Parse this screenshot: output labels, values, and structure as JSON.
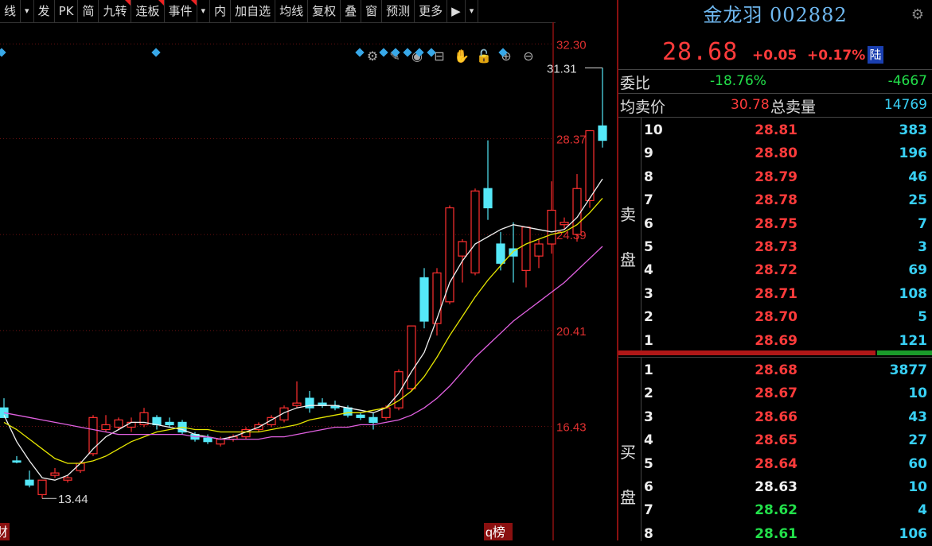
{
  "toolbar": {
    "items": [
      {
        "label": "线",
        "flag": false
      },
      {
        "label": "▾",
        "flag": false
      },
      {
        "label": "发",
        "flag": false
      },
      {
        "label": "PK",
        "flag": false
      },
      {
        "label": "简",
        "flag": false
      },
      {
        "label": "九转",
        "flag": true
      },
      {
        "label": "连板",
        "flag": true
      },
      {
        "label": "事件",
        "flag": true
      },
      {
        "label": "▾",
        "flag": false
      },
      {
        "label": "内",
        "flag": false
      },
      {
        "label": "加自选",
        "flag": false
      },
      {
        "label": "均线",
        "flag": false
      },
      {
        "label": "复权",
        "flag": false
      },
      {
        "label": "叠",
        "flag": false
      },
      {
        "label": "窗",
        "flag": false
      },
      {
        "label": "预测",
        "flag": false
      },
      {
        "label": "更多",
        "flag": false
      },
      {
        "label": "▶",
        "flag": false
      },
      {
        "label": "▾",
        "flag": false
      }
    ]
  },
  "chart_tools": [
    "gear-icon",
    "pen-icon",
    "eye-icon",
    "lock-box-icon",
    "hand-icon",
    "lock-icon",
    "zoom-in-icon",
    "zoom-out-icon"
  ],
  "chart_tool_glyphs": [
    "⚙",
    "✎",
    "◉",
    "⊟",
    "✋",
    "🔓",
    "⊕",
    "⊖"
  ],
  "chart_data": {
    "type": "candlestick",
    "y_ticks": [
      "32.30",
      "28.37",
      "24.39",
      "20.41",
      "16.43"
    ],
    "y_tick_values": [
      32.3,
      28.37,
      24.39,
      20.41,
      16.43
    ],
    "ylim": [
      11.7,
      33.2
    ],
    "annotations": [
      {
        "text": "31.31",
        "value": 31.31,
        "kind": "high"
      },
      {
        "text": "13.44",
        "value": 13.44,
        "kind": "low"
      }
    ],
    "bottom_labels": [
      "财",
      "q榜"
    ],
    "candles": [
      {
        "o": 17.2,
        "h": 17.6,
        "l": 17.0,
        "c": 16.8
      },
      {
        "o": 15.0,
        "h": 15.2,
        "l": 14.9,
        "c": 14.95
      },
      {
        "o": 14.2,
        "h": 14.6,
        "l": 13.9,
        "c": 14.0
      },
      {
        "o": 13.6,
        "h": 14.2,
        "l": 13.44,
        "c": 14.2
      },
      {
        "o": 14.4,
        "h": 14.7,
        "l": 14.3,
        "c": 14.5
      },
      {
        "o": 14.2,
        "h": 14.4,
        "l": 14.1,
        "c": 14.3
      },
      {
        "o": 14.6,
        "h": 15.0,
        "l": 14.5,
        "c": 14.9
      },
      {
        "o": 15.3,
        "h": 16.9,
        "l": 15.2,
        "c": 16.8
      },
      {
        "o": 16.3,
        "h": 16.9,
        "l": 16.2,
        "c": 16.5
      },
      {
        "o": 16.4,
        "h": 16.8,
        "l": 16.3,
        "c": 16.7
      },
      {
        "o": 16.4,
        "h": 16.8,
        "l": 16.2,
        "c": 16.6
      },
      {
        "o": 16.5,
        "h": 17.2,
        "l": 16.4,
        "c": 17.0
      },
      {
        "o": 16.8,
        "h": 16.9,
        "l": 16.3,
        "c": 16.5
      },
      {
        "o": 16.6,
        "h": 16.8,
        "l": 16.4,
        "c": 16.5
      },
      {
        "o": 16.6,
        "h": 16.7,
        "l": 16.1,
        "c": 16.2
      },
      {
        "o": 16.1,
        "h": 16.2,
        "l": 15.8,
        "c": 15.9
      },
      {
        "o": 15.95,
        "h": 16.1,
        "l": 15.7,
        "c": 15.8
      },
      {
        "o": 15.7,
        "h": 16.0,
        "l": 15.6,
        "c": 15.9
      },
      {
        "o": 15.9,
        "h": 16.1,
        "l": 15.8,
        "c": 16.0
      },
      {
        "o": 16.0,
        "h": 16.4,
        "l": 15.9,
        "c": 16.3
      },
      {
        "o": 16.3,
        "h": 16.6,
        "l": 16.2,
        "c": 16.5
      },
      {
        "o": 16.5,
        "h": 16.9,
        "l": 16.4,
        "c": 16.8
      },
      {
        "o": 16.7,
        "h": 17.3,
        "l": 16.6,
        "c": 17.2
      },
      {
        "o": 17.3,
        "h": 18.3,
        "l": 17.2,
        "c": 17.4
      },
      {
        "o": 17.6,
        "h": 17.9,
        "l": 17.0,
        "c": 17.2
      },
      {
        "o": 17.4,
        "h": 17.6,
        "l": 17.2,
        "c": 17.3
      },
      {
        "o": 17.3,
        "h": 17.5,
        "l": 17.1,
        "c": 17.2
      },
      {
        "o": 17.2,
        "h": 17.3,
        "l": 16.8,
        "c": 16.9
      },
      {
        "o": 16.9,
        "h": 17.0,
        "l": 16.7,
        "c": 16.8
      },
      {
        "o": 16.8,
        "h": 17.0,
        "l": 16.3,
        "c": 16.6
      },
      {
        "o": 16.8,
        "h": 17.3,
        "l": 16.7,
        "c": 17.2
      },
      {
        "o": 17.2,
        "h": 18.8,
        "l": 17.1,
        "c": 18.7
      },
      {
        "o": 18.0,
        "h": 20.6,
        "l": 17.9,
        "c": 20.6
      },
      {
        "o": 22.6,
        "h": 23.0,
        "l": 20.5,
        "c": 20.8
      },
      {
        "o": 20.7,
        "h": 23.0,
        "l": 20.2,
        "c": 22.8
      },
      {
        "o": 21.6,
        "h": 25.6,
        "l": 21.5,
        "c": 25.5
      },
      {
        "o": 23.5,
        "h": 24.2,
        "l": 22.4,
        "c": 24.1
      },
      {
        "o": 22.8,
        "h": 26.3,
        "l": 22.7,
        "c": 26.2
      },
      {
        "o": 26.3,
        "h": 28.3,
        "l": 25.0,
        "c": 25.5
      },
      {
        "o": 24.0,
        "h": 24.5,
        "l": 22.9,
        "c": 23.2
      },
      {
        "o": 23.8,
        "h": 24.9,
        "l": 22.4,
        "c": 23.5
      },
      {
        "o": 22.9,
        "h": 24.7,
        "l": 22.2,
        "c": 24.7
      },
      {
        "o": 23.5,
        "h": 24.2,
        "l": 23.0,
        "c": 24.0
      },
      {
        "o": 24.0,
        "h": 26.6,
        "l": 23.6,
        "c": 25.4
      },
      {
        "o": 24.8,
        "h": 25.1,
        "l": 24.6,
        "c": 24.9
      },
      {
        "o": 24.4,
        "h": 26.9,
        "l": 24.1,
        "c": 26.3
      },
      {
        "o": 25.8,
        "h": 28.7,
        "l": 25.5,
        "c": 28.7
      },
      {
        "o": 28.9,
        "h": 31.31,
        "l": 28.0,
        "c": 28.3
      }
    ],
    "ma": [
      {
        "name": "MA5",
        "color": "#f0f0f0",
        "values": [
          16.9,
          15.8,
          15.0,
          14.3,
          14.2,
          14.4,
          14.9,
          15.5,
          16.0,
          16.3,
          16.6,
          16.6,
          16.5,
          16.4,
          16.3,
          16.1,
          16.0,
          15.9,
          16.0,
          16.2,
          16.4,
          16.7,
          17.0,
          17.2,
          17.3,
          17.3,
          17.3,
          17.2,
          17.1,
          17.0,
          17.2,
          17.8,
          18.7,
          19.5,
          20.9,
          22.4,
          23.3,
          24.0,
          24.3,
          24.6,
          24.8,
          24.7,
          24.6,
          24.5,
          24.6,
          25.1,
          25.9,
          26.7
        ]
      },
      {
        "name": "MA10",
        "color": "#e6e600",
        "values": [
          16.6,
          16.3,
          15.9,
          15.5,
          15.1,
          14.9,
          14.9,
          15.0,
          15.2,
          15.5,
          15.8,
          16.0,
          16.2,
          16.3,
          16.4,
          16.3,
          16.3,
          16.2,
          16.2,
          16.2,
          16.2,
          16.3,
          16.4,
          16.5,
          16.7,
          16.8,
          16.9,
          17.0,
          17.0,
          17.1,
          17.2,
          17.5,
          17.9,
          18.5,
          19.3,
          20.2,
          21.0,
          21.8,
          22.5,
          23.1,
          23.7,
          24.0,
          24.2,
          24.4,
          24.5,
          24.8,
          25.3,
          25.9
        ]
      },
      {
        "name": "MA20",
        "color": "#e060e0",
        "values": [
          17.0,
          16.9,
          16.8,
          16.7,
          16.6,
          16.5,
          16.4,
          16.3,
          16.2,
          16.1,
          16.1,
          16.1,
          16.1,
          16.1,
          16.1,
          16.0,
          16.0,
          15.9,
          15.9,
          15.9,
          15.9,
          16.0,
          16.0,
          16.1,
          16.2,
          16.3,
          16.4,
          16.4,
          16.5,
          16.5,
          16.6,
          16.7,
          16.9,
          17.2,
          17.6,
          18.1,
          18.7,
          19.3,
          19.8,
          20.3,
          20.8,
          21.2,
          21.6,
          22.0,
          22.4,
          22.9,
          23.4,
          23.9
        ]
      }
    ]
  },
  "quote": {
    "title": "金龙羽 002882",
    "price": "28.68",
    "change": "+0.05",
    "change_pct": "+0.17%",
    "market": "陆",
    "ratio_label": "委比",
    "ratio_pct": "-18.76%",
    "ratio_val": "-4667",
    "avg_label": "均卖价",
    "avg_val": "30.78",
    "total_label": "总卖量",
    "total_val": "14769",
    "sell_side": "卖盘",
    "buy_side": "买盘",
    "sells": [
      {
        "n": "10",
        "p": "28.81",
        "s": "383"
      },
      {
        "n": "9",
        "p": "28.80",
        "s": "196"
      },
      {
        "n": "8",
        "p": "28.79",
        "s": "46"
      },
      {
        "n": "7",
        "p": "28.78",
        "s": "25"
      },
      {
        "n": "6",
        "p": "28.75",
        "s": "7"
      },
      {
        "n": "5",
        "p": "28.73",
        "s": "3"
      },
      {
        "n": "4",
        "p": "28.72",
        "s": "69"
      },
      {
        "n": "3",
        "p": "28.71",
        "s": "108"
      },
      {
        "n": "2",
        "p": "28.70",
        "s": "5"
      },
      {
        "n": "1",
        "p": "28.69",
        "s": "121"
      }
    ],
    "buys": [
      {
        "n": "1",
        "p": "28.68",
        "s": "3877",
        "c": "red"
      },
      {
        "n": "2",
        "p": "28.67",
        "s": "10",
        "c": "red"
      },
      {
        "n": "3",
        "p": "28.66",
        "s": "43",
        "c": "red"
      },
      {
        "n": "4",
        "p": "28.65",
        "s": "27",
        "c": "red"
      },
      {
        "n": "5",
        "p": "28.64",
        "s": "60",
        "c": "red"
      },
      {
        "n": "6",
        "p": "28.63",
        "s": "10",
        "c": "white"
      },
      {
        "n": "7",
        "p": "28.62",
        "s": "4",
        "c": "green"
      },
      {
        "n": "8",
        "p": "28.61",
        "s": "106",
        "c": "green"
      }
    ]
  }
}
